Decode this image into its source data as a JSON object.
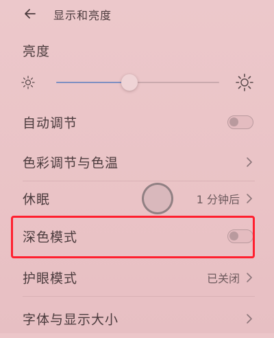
{
  "header": {
    "title": "显示和亮度",
    "back_icon": "arrow-left-icon"
  },
  "brightness": {
    "label": "亮度",
    "level": 0.45,
    "min_icon": "sun-small-icon",
    "max_icon": "sun-large-icon"
  },
  "items": [
    {
      "label": "自动调节",
      "control": "toggle",
      "on": false
    },
    {
      "label": "色彩调节与色温",
      "control": "chevron"
    },
    {
      "label": "休眠",
      "control": "chevron",
      "value": "1 分钟后"
    },
    {
      "label": "深色模式",
      "control": "toggle",
      "on": false
    },
    {
      "label": "护眼模式",
      "control": "chevron",
      "value": "已关闭"
    },
    {
      "label": "字体与显示大小",
      "control": "chevron"
    }
  ],
  "colors": {
    "background": "#ecc6c9",
    "highlight": "#ff1f2e",
    "slider_fill": "#7c8fc2"
  }
}
